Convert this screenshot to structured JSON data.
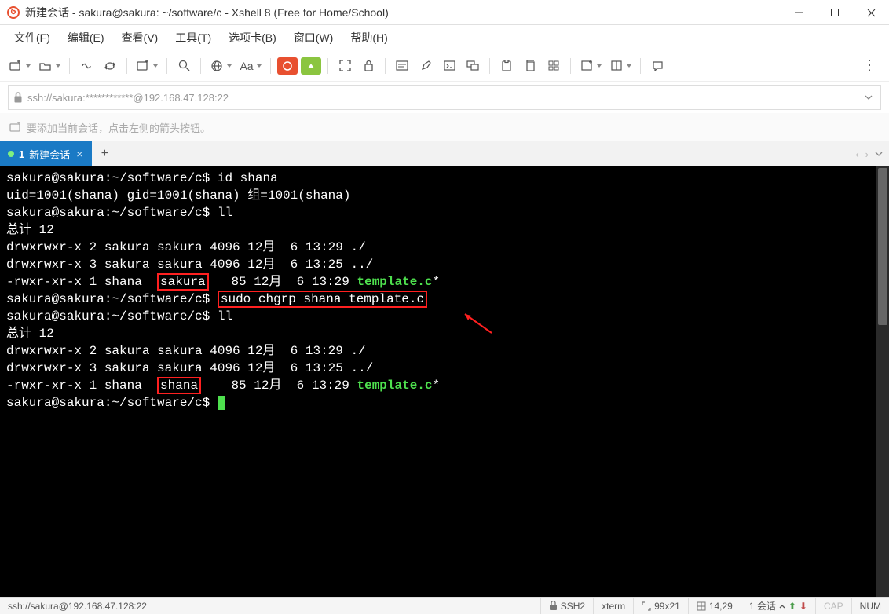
{
  "titlebar": {
    "title": "新建会话 - sakura@sakura: ~/software/c - Xshell 8 (Free for Home/School)"
  },
  "menu": {
    "file": "文件(F)",
    "edit": "编辑(E)",
    "view": "查看(V)",
    "tools": "工具(T)",
    "tabs": "选项卡(B)",
    "window": "窗口(W)",
    "help": "帮助(H)"
  },
  "addressbar": {
    "url": "ssh://sakura:************@192.168.47.128:22"
  },
  "hintbar": {
    "text": "要添加当前会话，点击左侧的箭头按钮。"
  },
  "tab": {
    "num": "1",
    "label": "新建会话"
  },
  "term": {
    "p": "sakura@sakura:~/software/c$",
    "cmd_id": "id shana",
    "out_id": "uid=1001(shana) gid=1001(shana) 组=1001(shana)",
    "cmd_ll1": "ll",
    "total": "总计 12",
    "row_dot1": "drwxrwxr-x 2 sakura sakura 4096 12月  6 13:29 ./",
    "row_ddot1": "drwxrwxr-x 3 sakura sakura 4096 12月  6 13:25 ../",
    "row_t1_a": "-rwxr-xr-x 1 shana  ",
    "row_t1_grp": "sakura",
    "row_t1_b": "   85 12月  6 13:29 ",
    "row_t1_file": "template.c",
    "row_t1_star": "*",
    "cmd_chgrp": "sudo chgrp shana template.c",
    "cmd_ll2": "ll",
    "row_dot2": "drwxrwxr-x 2 sakura sakura 4096 12月  6 13:29 ./",
    "row_ddot2": "drwxrwxr-x 3 sakura sakura 4096 12月  6 13:25 ../",
    "row_t2_a": "-rwxr-xr-x 1 shana  ",
    "row_t2_grp": "shana",
    "row_t2_b": "    85 12月  6 13:29 ",
    "row_t2_file": "template.c",
    "row_t2_star": "*"
  },
  "status": {
    "url": "ssh://sakura@192.168.47.128:22",
    "proto": "SSH2",
    "term": "xterm",
    "size": "99x21",
    "cursor": "14,29",
    "session": "1 会话",
    "cap": "CAP",
    "num": "NUM"
  }
}
